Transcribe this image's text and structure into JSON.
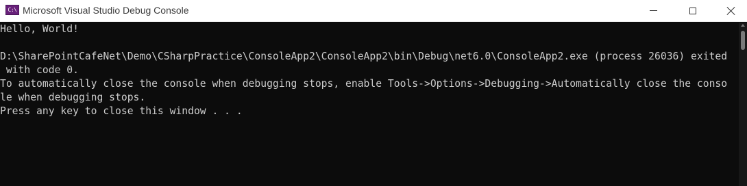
{
  "window": {
    "icon_text": "C:\\",
    "title": "Microsoft Visual Studio Debug Console"
  },
  "console": {
    "lines": [
      "Hello, World!",
      "",
      "D:\\SharePointCafeNet\\Demo\\CSharpPractice\\ConsoleApp2\\ConsoleApp2\\bin\\Debug\\net6.0\\ConsoleApp2.exe (process 26036) exited",
      " with code 0.",
      "To automatically close the console when debugging stops, enable Tools->Options->Debugging->Automatically close the conso",
      "le when debugging stops.",
      "Press any key to close this window . . ."
    ],
    "text_color": "#cccccc",
    "background_color": "#0c0c0c"
  }
}
